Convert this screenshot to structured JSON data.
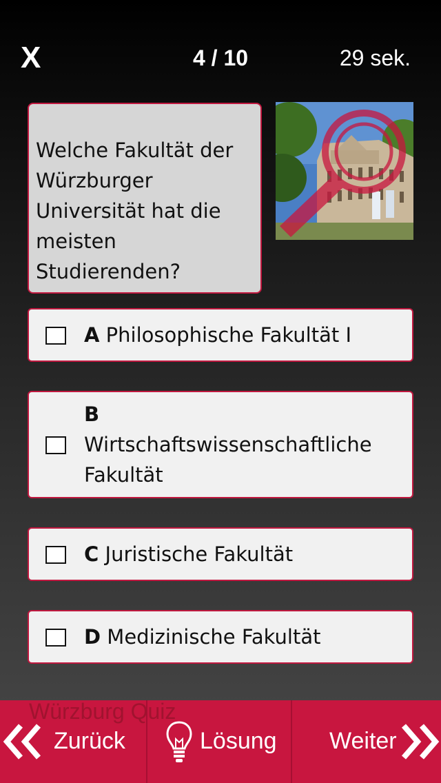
{
  "header": {
    "close_label": "X",
    "progress": "4 / 10",
    "timer": "29 sek."
  },
  "question": {
    "text": "Welche Fakultät der Würzburger Universität hat die meisten Studierenden?"
  },
  "answers": [
    {
      "letter": "A",
      "text": "Philosophische Fakultät I"
    },
    {
      "letter": "B",
      "text": "Wirtschaftswissenschaftliche Fakultät"
    },
    {
      "letter": "C",
      "text": "Juristische Fakultät"
    },
    {
      "letter": "D",
      "text": "Medizinische Fakultät"
    }
  ],
  "footer": {
    "watermark": "Würzburg Quiz",
    "back_label": "Zurück",
    "hint_label": "Lösung",
    "next_label": "Weiter"
  },
  "colors": {
    "accent": "#c8163f",
    "question_bg": "#d6d6d6",
    "answer_bg": "#f1f1f1"
  }
}
